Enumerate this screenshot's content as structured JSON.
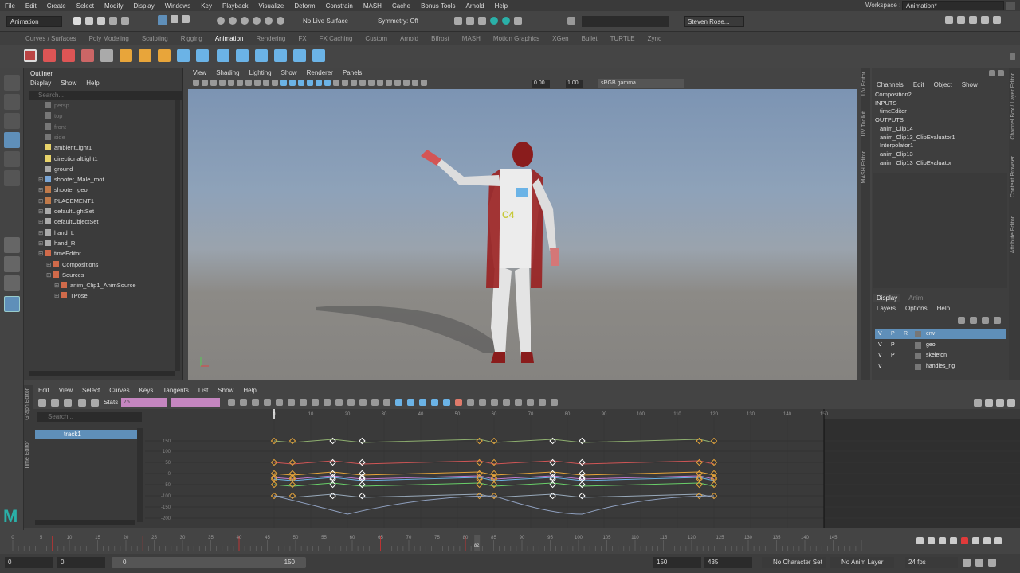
{
  "menubar": [
    "File",
    "Edit",
    "Create",
    "Select",
    "Modify",
    "Display",
    "Windows",
    "Key",
    "Playback",
    "Visualize",
    "Deform",
    "Constrain",
    "MASH",
    "Cache",
    "Bonus Tools",
    "Arnold",
    "Help"
  ],
  "workspace": {
    "label": "Workspace :",
    "value": "Animation*"
  },
  "status_line": {
    "menuset": "Animation",
    "live_surface": "No Live Surface",
    "symmetry": "Symmetry: Off",
    "user": "Steven Rose..."
  },
  "shelf_tabs": [
    "Curves / Surfaces",
    "Poly Modeling",
    "Sculpting",
    "Rigging",
    "Animation",
    "Rendering",
    "FX",
    "FX Caching",
    "Custom",
    "Arnold",
    "Bifrost",
    "MASH",
    "Motion Graphics",
    "XGen",
    "Bullet",
    "TURTLE",
    "Zync"
  ],
  "shelf_active": "Animation",
  "outliner": {
    "title": "Outliner",
    "menu": [
      "Display",
      "Show",
      "Help"
    ],
    "search_placeholder": "Search...",
    "items": [
      {
        "label": "persp",
        "dim": true,
        "indent": 0
      },
      {
        "label": "top",
        "dim": true,
        "indent": 0
      },
      {
        "label": "front",
        "dim": true,
        "indent": 0
      },
      {
        "label": "side",
        "dim": true,
        "indent": 0
      },
      {
        "label": "ambientLight1",
        "dim": false,
        "indent": 0
      },
      {
        "label": "directionalLight1",
        "dim": false,
        "indent": 0
      },
      {
        "label": "ground",
        "dim": false,
        "indent": 0
      },
      {
        "label": "shooter_Male_root",
        "dim": false,
        "indent": 0
      },
      {
        "label": "shooter_geo",
        "dim": false,
        "indent": 0
      },
      {
        "label": "PLACEMENT1",
        "dim": false,
        "indent": 0
      },
      {
        "label": "defaultLightSet",
        "dim": false,
        "indent": 0
      },
      {
        "label": "defaultObjectSet",
        "dim": false,
        "indent": 0
      },
      {
        "label": "hand_L",
        "dim": false,
        "indent": 0
      },
      {
        "label": "hand_R",
        "dim": false,
        "indent": 0
      },
      {
        "label": "timeEditor",
        "dim": false,
        "indent": 0
      },
      {
        "label": "Compositions",
        "dim": false,
        "indent": 1
      },
      {
        "label": "Sources",
        "dim": false,
        "indent": 1
      },
      {
        "label": "anim_Clip1_AnimSource",
        "dim": false,
        "indent": 2
      },
      {
        "label": "TPose",
        "dim": false,
        "indent": 2
      }
    ]
  },
  "viewport": {
    "menu": [
      "View",
      "Shading",
      "Lighting",
      "Show",
      "Renderer",
      "Panels"
    ],
    "exposure": "0.00",
    "gamma": "1.00",
    "colorspace": "sRGB gamma"
  },
  "side_tabs_left": [
    "UV Editor",
    "UV Toolkit",
    "MASH Editor"
  ],
  "side_tabs_right": [
    "Channel Box / Layer Editor",
    "Content Browser",
    "Attribute Editor"
  ],
  "channel_box": {
    "menu": [
      "Channels",
      "Edit",
      "Object",
      "Show"
    ],
    "lines": [
      {
        "text": "Composition2",
        "indent": 0
      },
      {
        "text": "INPUTS",
        "indent": 0
      },
      {
        "text": "timeEditor",
        "indent": 1
      },
      {
        "text": "OUTPUTS",
        "indent": 0
      },
      {
        "text": "anim_Clip14",
        "indent": 1
      },
      {
        "text": "anim_Clip13_ClipEvaluator1",
        "indent": 1
      },
      {
        "text": "Interpolator1",
        "indent": 1
      },
      {
        "text": "anim_Clip13",
        "indent": 1
      },
      {
        "text": "anim_Clip13_ClipEvaluator",
        "indent": 1
      }
    ]
  },
  "layer_editor": {
    "tabs": [
      "Display",
      "Anim"
    ],
    "menu": [
      "Layers",
      "Options",
      "Help"
    ],
    "layers": [
      {
        "v": "V",
        "p": "P",
        "r": "R",
        "name": "env",
        "selected": true
      },
      {
        "v": "V",
        "p": "P",
        "r": "",
        "name": "geo",
        "selected": false
      },
      {
        "v": "V",
        "p": "P",
        "r": "",
        "name": "skeleton",
        "selected": false
      },
      {
        "v": "V",
        "p": "",
        "r": "",
        "name": "handles_rig",
        "selected": false
      }
    ]
  },
  "graph_editor": {
    "menu": [
      "Edit",
      "View",
      "Select",
      "Curves",
      "Keys",
      "Tangents",
      "List",
      "Show",
      "Help"
    ],
    "stats_label": "Stats",
    "stats_value": "76",
    "search_placeholder": "Search...",
    "track": "track1",
    "ruler": [
      "0",
      "10",
      "20",
      "30",
      "40",
      "50",
      "60",
      "70",
      "80",
      "90",
      "100",
      "110",
      "120",
      "130",
      "140",
      "150"
    ],
    "y_ticks": [
      "150",
      "100",
      "50",
      "0",
      "-50",
      "-100",
      "-150",
      "-200"
    ],
    "side_label_top": "Graph Editor",
    "side_label_bottom": "Time Editor"
  },
  "time_slider": {
    "ticks": [
      "0",
      "5",
      "10",
      "15",
      "20",
      "25",
      "30",
      "35",
      "40",
      "45",
      "50",
      "55",
      "60",
      "65",
      "70",
      "75",
      "80",
      "85",
      "90",
      "95",
      "100",
      "105",
      "110",
      "115",
      "120",
      "125",
      "130",
      "135",
      "140",
      "145"
    ],
    "current_frame": "82",
    "current_frame_value": 82
  },
  "range_slider": {
    "start": "0",
    "playback_start": "0",
    "range_start": "0",
    "range_end": "150",
    "playback_end": "150",
    "end": "435",
    "character_set": "No Character Set",
    "anim_layer": "No Anim Layer",
    "fps": "24 fps"
  },
  "colors": {
    "accent": "#5285a6",
    "select": "#5f8fb9",
    "key_orange": "#e8a53a",
    "record_red": "#e03a3a",
    "maya_teal": "#2ab0a8"
  }
}
